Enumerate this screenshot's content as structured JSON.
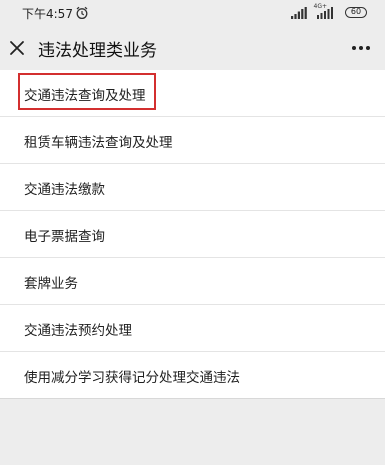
{
  "status_bar": {
    "time": "下午4:57",
    "network": "4G+",
    "battery": "60"
  },
  "nav": {
    "title": "违法处理类业务"
  },
  "menu": {
    "items": [
      {
        "label": "交通违法查询及处理"
      },
      {
        "label": "租赁车辆违法查询及处理"
      },
      {
        "label": "交通违法缴款"
      },
      {
        "label": "电子票据查询"
      },
      {
        "label": "套牌业务"
      },
      {
        "label": "交通违法预约处理"
      },
      {
        "label": "使用减分学习获得记分处理交通违法"
      }
    ]
  },
  "colors": {
    "background": "#ededed",
    "list_background": "#ffffff",
    "highlight": "#d32f2f"
  },
  "icons": [
    "alarm-icon",
    "signal-icon",
    "battery-icon",
    "close-icon",
    "more-icon"
  ]
}
